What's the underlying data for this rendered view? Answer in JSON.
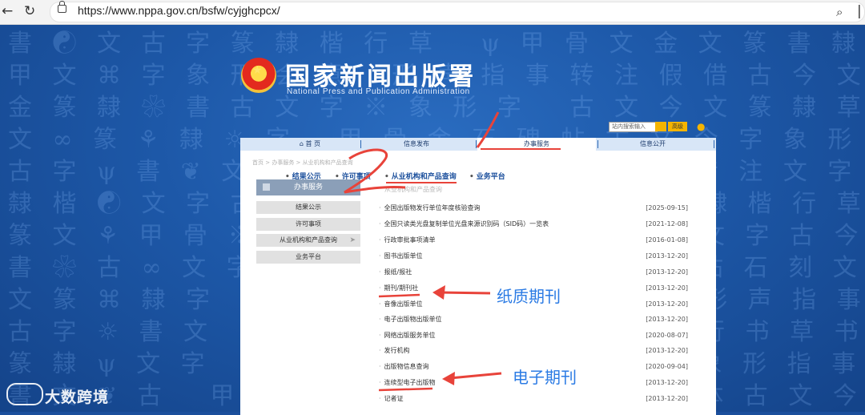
{
  "browser": {
    "url": "https://www.nppa.gov.cn/bsfw/cyjghcpcx/",
    "back_icon": "arrow-left-icon",
    "refresh_icon": "refresh-icon",
    "zoom_icon": "zoom-icon",
    "share_icon": "share-icon"
  },
  "header": {
    "title": "国家新闻出版署",
    "subtitle": "National  Press and Publication Administration",
    "search_placeholder": "站内搜索输入",
    "search_advanced": "高级"
  },
  "main_nav": {
    "items": [
      "首 页",
      "信息发布",
      "办事服务",
      "信息公开"
    ],
    "active_index": 2
  },
  "breadcrumb": "首页 > 办事服务 > 从业机构和产品查询",
  "sub_nav": [
    "结果公示",
    "许可事项",
    "从业机构和产品查询",
    "业务平台"
  ],
  "sidebar": {
    "heading": "办事服务",
    "items": [
      "结果公示",
      "许可事项",
      "从业机构和产品查询",
      "业务平台"
    ]
  },
  "list_title": "从业机构和产品查询",
  "list": [
    {
      "title": "全国出版物发行单位年度核验查询",
      "date": "[2025-09-15]"
    },
    {
      "title": "全国只读类光盘复制单位光盘来源识别码（SID码）一览表",
      "date": "[2021-12-08]"
    },
    {
      "title": "行政审批事项清单",
      "date": "[2016-01-08]"
    },
    {
      "title": "图书出版单位",
      "date": "[2013-12-20]"
    },
    {
      "title": "报纸/报社",
      "date": "[2013-12-20]"
    },
    {
      "title": "期刊/期刊社",
      "date": "[2013-12-20]"
    },
    {
      "title": "音像出版单位",
      "date": "[2013-12-20]"
    },
    {
      "title": "电子出版物出版单位",
      "date": "[2013-12-20]"
    },
    {
      "title": "网络出版服务单位",
      "date": "[2020-08-07]"
    },
    {
      "title": "发行机构",
      "date": "[2013-12-20]"
    },
    {
      "title": "出版物信息查询",
      "date": "[2020-09-04]"
    },
    {
      "title": "连续型电子出版物",
      "date": "[2013-12-20]"
    },
    {
      "title": "记者证",
      "date": "[2013-12-20]"
    }
  ],
  "annotations": {
    "paper_journal": "纸质期刊",
    "electronic_journal": "电子期刊",
    "step1": "1",
    "step2": "2",
    "color": "#e8433a",
    "text_color": "#2b7be4"
  },
  "watermark": "大数跨境"
}
